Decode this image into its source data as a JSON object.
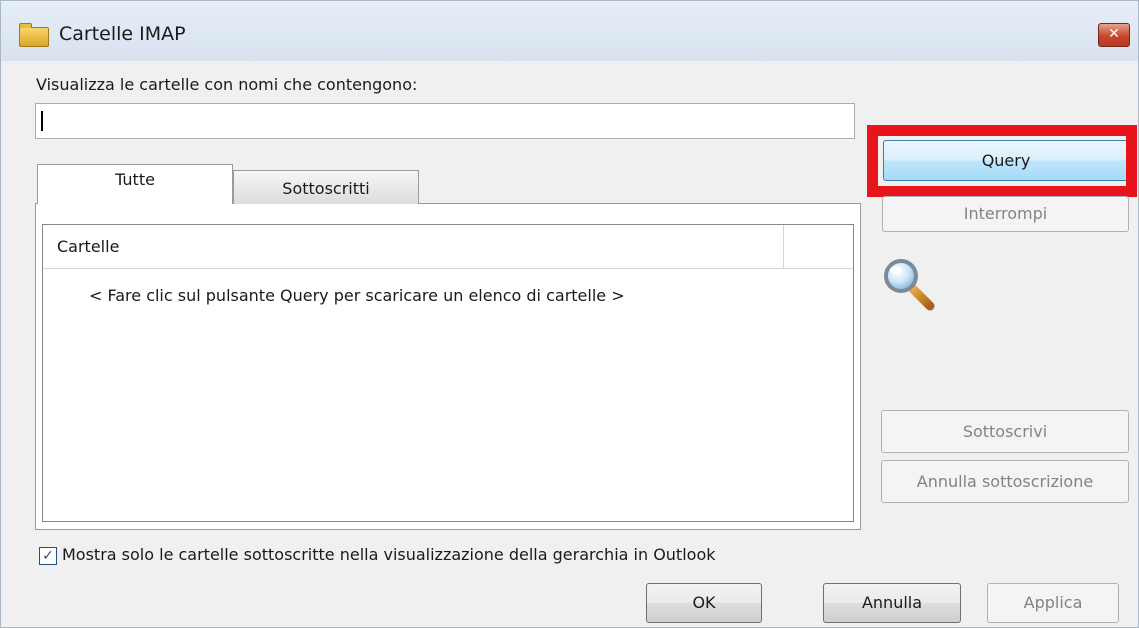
{
  "window": {
    "title": "Cartelle IMAP",
    "close_symbol": "✕"
  },
  "filter": {
    "label": "Visualizza le cartelle con nomi che contengono:",
    "value": ""
  },
  "tabs": [
    {
      "label": "Tutte",
      "active": true
    },
    {
      "label": "Sottoscritti",
      "active": false
    }
  ],
  "folder_list": {
    "column_header": "Cartelle",
    "empty_message": "< Fare clic sul pulsante Query per scaricare un elenco di cartelle >"
  },
  "side_buttons": {
    "query": "Query",
    "stop": "Interrompi",
    "subscribe": "Sottoscrivi",
    "unsubscribe": "Annulla sottoscrizione"
  },
  "icons": {
    "title": "folder-icon",
    "search": "magnifier-icon"
  },
  "option": {
    "label": "Mostra solo le cartelle sottoscritte nella visualizzazione della gerarchia in Outlook",
    "checked": true,
    "check_symbol": "✓"
  },
  "footer": {
    "ok": "OK",
    "cancel": "Annulla",
    "apply": "Applica"
  },
  "colors": {
    "highlight": "#e8141b",
    "query_button": "#bee6fd"
  }
}
